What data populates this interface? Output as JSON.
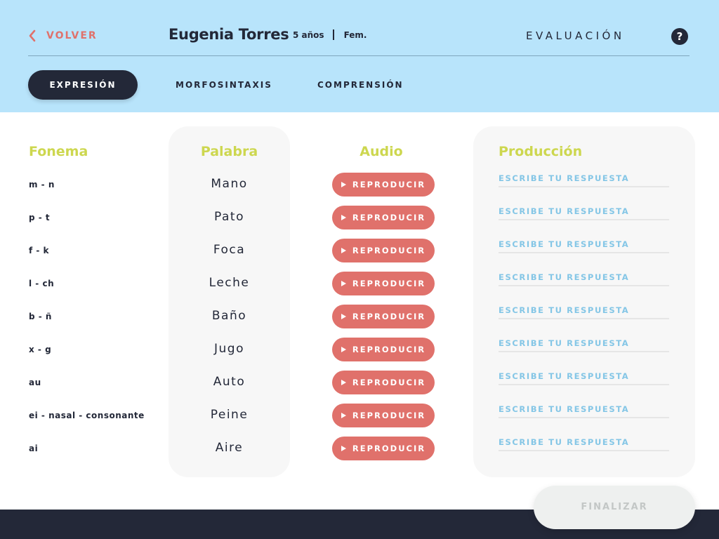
{
  "header": {
    "back_label": "VOLVER",
    "patient_name": "Eugenia Torres",
    "patient_age": "5 años",
    "patient_sex": "Fem.",
    "section_title": "EVALUACIÓN",
    "help_label": "?"
  },
  "tabs": [
    {
      "label": "EXPRESIÓN",
      "active": true
    },
    {
      "label": "MORFOSINTAXIS",
      "active": false
    },
    {
      "label": "COMPRENSIÓN",
      "active": false
    }
  ],
  "columns": {
    "phoneme": "Fonema",
    "word": "Palabra",
    "audio": "Audio",
    "production": "Producción"
  },
  "rows": [
    {
      "phoneme": "m - n",
      "word": "Mano",
      "audio_label": "REPRODUCIR",
      "answer_placeholder": "ESCRIBE TU RESPUESTA",
      "answer_value": ""
    },
    {
      "phoneme": "p - t",
      "word": "Pato",
      "audio_label": "REPRODUCIR",
      "answer_placeholder": "ESCRIBE TU RESPUESTA",
      "answer_value": ""
    },
    {
      "phoneme": "f - k",
      "word": "Foca",
      "audio_label": "REPRODUCIR",
      "answer_placeholder": "ESCRIBE TU RESPUESTA",
      "answer_value": ""
    },
    {
      "phoneme": "l - ch",
      "word": "Leche",
      "audio_label": "REPRODUCIR",
      "answer_placeholder": "ESCRIBE TU RESPUESTA",
      "answer_value": ""
    },
    {
      "phoneme": "b - ñ",
      "word": "Baño",
      "audio_label": "REPRODUCIR",
      "answer_placeholder": "ESCRIBE TU RESPUESTA",
      "answer_value": ""
    },
    {
      "phoneme": "x - g",
      "word": "Jugo",
      "audio_label": "REPRODUCIR",
      "answer_placeholder": "ESCRIBE TU RESPUESTA",
      "answer_value": ""
    },
    {
      "phoneme": "au",
      "word": "Auto",
      "audio_label": "REPRODUCIR",
      "answer_placeholder": "ESCRIBE TU RESPUESTA",
      "answer_value": ""
    },
    {
      "phoneme": "ei - nasal - consonante",
      "word": "Peine",
      "audio_label": "REPRODUCIR",
      "answer_placeholder": "ESCRIBE TU RESPUESTA",
      "answer_value": ""
    },
    {
      "phoneme": "ai",
      "word": "Aire",
      "audio_label": "REPRODUCIR",
      "answer_placeholder": "ESCRIBE TU RESPUESTA",
      "answer_value": ""
    }
  ],
  "footer": {
    "finish_label": "FINALIZAR",
    "finish_enabled": false
  },
  "icons": {
    "back": "chevron-left-icon",
    "play": "play-icon",
    "help": "question-mark-icon"
  },
  "colors": {
    "header_bg": "#b8e4fb",
    "dark": "#232838",
    "accent_red": "#e0716b",
    "column_title": "#cdd74f",
    "placeholder_blue": "#84c6e6",
    "panel_bg": "#f7f7f7",
    "finish_disabled_bg": "#eef0ef",
    "finish_disabled_text": "#c3c7c6"
  }
}
